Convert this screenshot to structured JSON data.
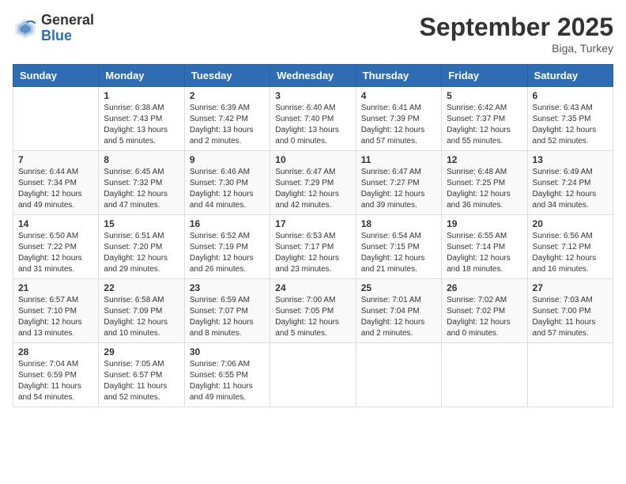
{
  "header": {
    "logo_general": "General",
    "logo_blue": "Blue",
    "month_title": "September 2025",
    "location": "Biga, Turkey"
  },
  "weekdays": [
    "Sunday",
    "Monday",
    "Tuesday",
    "Wednesday",
    "Thursday",
    "Friday",
    "Saturday"
  ],
  "weeks": [
    [
      {
        "day": "",
        "sunrise": "",
        "sunset": "",
        "daylight": ""
      },
      {
        "day": "1",
        "sunrise": "Sunrise: 6:38 AM",
        "sunset": "Sunset: 7:43 PM",
        "daylight": "Daylight: 13 hours and 5 minutes."
      },
      {
        "day": "2",
        "sunrise": "Sunrise: 6:39 AM",
        "sunset": "Sunset: 7:42 PM",
        "daylight": "Daylight: 13 hours and 2 minutes."
      },
      {
        "day": "3",
        "sunrise": "Sunrise: 6:40 AM",
        "sunset": "Sunset: 7:40 PM",
        "daylight": "Daylight: 13 hours and 0 minutes."
      },
      {
        "day": "4",
        "sunrise": "Sunrise: 6:41 AM",
        "sunset": "Sunset: 7:39 PM",
        "daylight": "Daylight: 12 hours and 57 minutes."
      },
      {
        "day": "5",
        "sunrise": "Sunrise: 6:42 AM",
        "sunset": "Sunset: 7:37 PM",
        "daylight": "Daylight: 12 hours and 55 minutes."
      },
      {
        "day": "6",
        "sunrise": "Sunrise: 6:43 AM",
        "sunset": "Sunset: 7:35 PM",
        "daylight": "Daylight: 12 hours and 52 minutes."
      }
    ],
    [
      {
        "day": "7",
        "sunrise": "Sunrise: 6:44 AM",
        "sunset": "Sunset: 7:34 PM",
        "daylight": "Daylight: 12 hours and 49 minutes."
      },
      {
        "day": "8",
        "sunrise": "Sunrise: 6:45 AM",
        "sunset": "Sunset: 7:32 PM",
        "daylight": "Daylight: 12 hours and 47 minutes."
      },
      {
        "day": "9",
        "sunrise": "Sunrise: 6:46 AM",
        "sunset": "Sunset: 7:30 PM",
        "daylight": "Daylight: 12 hours and 44 minutes."
      },
      {
        "day": "10",
        "sunrise": "Sunrise: 6:47 AM",
        "sunset": "Sunset: 7:29 PM",
        "daylight": "Daylight: 12 hours and 42 minutes."
      },
      {
        "day": "11",
        "sunrise": "Sunrise: 6:47 AM",
        "sunset": "Sunset: 7:27 PM",
        "daylight": "Daylight: 12 hours and 39 minutes."
      },
      {
        "day": "12",
        "sunrise": "Sunrise: 6:48 AM",
        "sunset": "Sunset: 7:25 PM",
        "daylight": "Daylight: 12 hours and 36 minutes."
      },
      {
        "day": "13",
        "sunrise": "Sunrise: 6:49 AM",
        "sunset": "Sunset: 7:24 PM",
        "daylight": "Daylight: 12 hours and 34 minutes."
      }
    ],
    [
      {
        "day": "14",
        "sunrise": "Sunrise: 6:50 AM",
        "sunset": "Sunset: 7:22 PM",
        "daylight": "Daylight: 12 hours and 31 minutes."
      },
      {
        "day": "15",
        "sunrise": "Sunrise: 6:51 AM",
        "sunset": "Sunset: 7:20 PM",
        "daylight": "Daylight: 12 hours and 29 minutes."
      },
      {
        "day": "16",
        "sunrise": "Sunrise: 6:52 AM",
        "sunset": "Sunset: 7:19 PM",
        "daylight": "Daylight: 12 hours and 26 minutes."
      },
      {
        "day": "17",
        "sunrise": "Sunrise: 6:53 AM",
        "sunset": "Sunset: 7:17 PM",
        "daylight": "Daylight: 12 hours and 23 minutes."
      },
      {
        "day": "18",
        "sunrise": "Sunrise: 6:54 AM",
        "sunset": "Sunset: 7:15 PM",
        "daylight": "Daylight: 12 hours and 21 minutes."
      },
      {
        "day": "19",
        "sunrise": "Sunrise: 6:55 AM",
        "sunset": "Sunset: 7:14 PM",
        "daylight": "Daylight: 12 hours and 18 minutes."
      },
      {
        "day": "20",
        "sunrise": "Sunrise: 6:56 AM",
        "sunset": "Sunset: 7:12 PM",
        "daylight": "Daylight: 12 hours and 16 minutes."
      }
    ],
    [
      {
        "day": "21",
        "sunrise": "Sunrise: 6:57 AM",
        "sunset": "Sunset: 7:10 PM",
        "daylight": "Daylight: 12 hours and 13 minutes."
      },
      {
        "day": "22",
        "sunrise": "Sunrise: 6:58 AM",
        "sunset": "Sunset: 7:09 PM",
        "daylight": "Daylight: 12 hours and 10 minutes."
      },
      {
        "day": "23",
        "sunrise": "Sunrise: 6:59 AM",
        "sunset": "Sunset: 7:07 PM",
        "daylight": "Daylight: 12 hours and 8 minutes."
      },
      {
        "day": "24",
        "sunrise": "Sunrise: 7:00 AM",
        "sunset": "Sunset: 7:05 PM",
        "daylight": "Daylight: 12 hours and 5 minutes."
      },
      {
        "day": "25",
        "sunrise": "Sunrise: 7:01 AM",
        "sunset": "Sunset: 7:04 PM",
        "daylight": "Daylight: 12 hours and 2 minutes."
      },
      {
        "day": "26",
        "sunrise": "Sunrise: 7:02 AM",
        "sunset": "Sunset: 7:02 PM",
        "daylight": "Daylight: 12 hours and 0 minutes."
      },
      {
        "day": "27",
        "sunrise": "Sunrise: 7:03 AM",
        "sunset": "Sunset: 7:00 PM",
        "daylight": "Daylight: 11 hours and 57 minutes."
      }
    ],
    [
      {
        "day": "28",
        "sunrise": "Sunrise: 7:04 AM",
        "sunset": "Sunset: 6:59 PM",
        "daylight": "Daylight: 11 hours and 54 minutes."
      },
      {
        "day": "29",
        "sunrise": "Sunrise: 7:05 AM",
        "sunset": "Sunset: 6:57 PM",
        "daylight": "Daylight: 11 hours and 52 minutes."
      },
      {
        "day": "30",
        "sunrise": "Sunrise: 7:06 AM",
        "sunset": "Sunset: 6:55 PM",
        "daylight": "Daylight: 11 hours and 49 minutes."
      },
      {
        "day": "",
        "sunrise": "",
        "sunset": "",
        "daylight": ""
      },
      {
        "day": "",
        "sunrise": "",
        "sunset": "",
        "daylight": ""
      },
      {
        "day": "",
        "sunrise": "",
        "sunset": "",
        "daylight": ""
      },
      {
        "day": "",
        "sunrise": "",
        "sunset": "",
        "daylight": ""
      }
    ]
  ]
}
